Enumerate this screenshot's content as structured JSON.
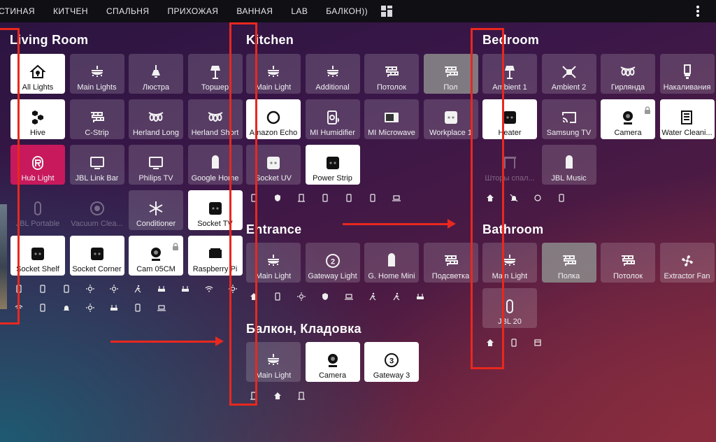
{
  "tabs": [
    "СТИНАЯ",
    "КИТЧЕН",
    "СПАЛЬНЯ",
    "ПРИХОЖАЯ",
    "ВАННАЯ",
    "LAB",
    "БАЛКОН))"
  ],
  "sections": {
    "living": "Living Room",
    "kitchen": "Kitchen",
    "bedroom": "Bedroom",
    "entrance": "Entrance",
    "bathroom": "Bathroom",
    "balcony": "Балкон, Кладовка"
  },
  "living": [
    {
      "label": "All Lights",
      "icon": "home-lightbulb-icon",
      "state": "on"
    },
    {
      "label": "Main Lights",
      "icon": "ceiling-light-icon",
      "state": "off"
    },
    {
      "label": "Люстра",
      "icon": "pendant-lamp-icon",
      "state": "off"
    },
    {
      "label": "Торшер",
      "icon": "floor-lamp-icon",
      "state": "off"
    },
    {
      "label": "Hive",
      "icon": "hexagon-icon",
      "state": "on"
    },
    {
      "label": "C-Strip",
      "icon": "led-strip-icon",
      "state": "off"
    },
    {
      "label": "Herland Long",
      "icon": "string-lights-icon",
      "state": "off"
    },
    {
      "label": "Herland Short",
      "icon": "string-lights-icon",
      "state": "off"
    },
    {
      "label": "Hub Light",
      "icon": "hub-icon",
      "state": "pink"
    },
    {
      "label": "JBL Link Bar",
      "icon": "monitor-icon",
      "state": "off"
    },
    {
      "label": "Philips TV",
      "icon": "monitor-icon",
      "state": "off"
    },
    {
      "label": "Google Home",
      "icon": "smart-speaker-icon",
      "state": "off"
    },
    {
      "label": "JBL Portable",
      "icon": "speaker-icon",
      "state": "dim"
    },
    {
      "label": "Vacuum Clea...",
      "icon": "robot-vacuum-icon",
      "state": "dim"
    },
    {
      "label": "Conditioner",
      "icon": "snowflake-icon",
      "state": "off"
    },
    {
      "label": "Socket TV",
      "icon": "socket-icon",
      "state": "on"
    },
    {
      "label": "Socket Shelf",
      "icon": "socket-icon",
      "state": "on"
    },
    {
      "label": "Socket Corner",
      "icon": "socket-icon",
      "state": "on"
    },
    {
      "label": "Cam 05CM",
      "icon": "webcam-icon",
      "state": "on",
      "lock": true
    },
    {
      "label": "Raspberry Pi",
      "icon": "raspberry-pi-icon",
      "state": "on"
    }
  ],
  "kitchen": [
    {
      "label": "Main Light",
      "icon": "ceiling-light-icon",
      "state": "off"
    },
    {
      "label": "Additional",
      "icon": "ceiling-light-icon",
      "state": "off"
    },
    {
      "label": "Потолок",
      "icon": "led-strip-icon",
      "state": "off"
    },
    {
      "label": "Пол",
      "icon": "led-strip-icon",
      "state": "gray"
    },
    {
      "label": "Amazon Echo",
      "icon": "echo-ring-icon",
      "state": "on"
    },
    {
      "label": "MI Humidifier",
      "icon": "humidifier-icon",
      "state": "off"
    },
    {
      "label": "MI Microwave",
      "icon": "microwave-icon",
      "state": "off"
    },
    {
      "label": "Workplace 1",
      "icon": "socket-icon",
      "state": "off"
    },
    {
      "label": "Socket UV",
      "icon": "socket-icon",
      "state": "off"
    },
    {
      "label": "Power Strip",
      "icon": "socket-icon",
      "state": "on"
    }
  ],
  "bedroom": [
    {
      "label": "Ambient 1",
      "icon": "floor-lamp-icon",
      "state": "off"
    },
    {
      "label": "Ambient 2",
      "icon": "spotlight-icon",
      "state": "off"
    },
    {
      "label": "Гирлянда",
      "icon": "string-lights-icon",
      "state": "off"
    },
    {
      "label": "Накаливания",
      "icon": "bulb-cfl-icon",
      "state": "off"
    },
    {
      "label": "Heater",
      "icon": "socket-icon",
      "state": "on"
    },
    {
      "label": "Samsung TV",
      "icon": "cast-icon",
      "state": "off"
    },
    {
      "label": "Camera",
      "icon": "webcam-icon",
      "state": "on",
      "lock": true
    },
    {
      "label": "Water Cleani...",
      "icon": "air-purifier-icon",
      "state": "on"
    },
    {
      "label": "Шторы спал...",
      "icon": "curtains-icon",
      "state": "dim"
    },
    {
      "label": "JBL Music",
      "icon": "smart-speaker-icon",
      "state": "off"
    }
  ],
  "entrance": [
    {
      "label": "Main Light",
      "icon": "ceiling-light-icon",
      "state": "off"
    },
    {
      "label": "Gateway Light",
      "icon": "gateway-2-icon",
      "state": "off"
    },
    {
      "label": "G. Home Mini",
      "icon": "smart-speaker-icon",
      "state": "off"
    },
    {
      "label": "Подсветка",
      "icon": "led-strip-icon",
      "state": "off"
    }
  ],
  "bathroom": [
    {
      "label": "Main Light",
      "icon": "ceiling-light-icon",
      "state": "off"
    },
    {
      "label": "Полка",
      "icon": "led-strip-icon",
      "state": "gray"
    },
    {
      "label": "Потолок",
      "icon": "led-strip-icon",
      "state": "off"
    },
    {
      "label": "Extractor Fan",
      "icon": "fan-icon",
      "state": "off"
    },
    {
      "label": "JBL 20",
      "icon": "speaker-icon",
      "state": "off"
    }
  ],
  "balcony": [
    {
      "label": "Main Light",
      "icon": "ceiling-light-icon",
      "state": "off"
    },
    {
      "label": "Camera",
      "icon": "webcam-icon",
      "state": "on"
    },
    {
      "label": "Gateway 3",
      "icon": "gateway-3-icon",
      "state": "on"
    }
  ],
  "colors": {
    "accent": "#c8195c",
    "annotation": "#e8281e",
    "topbar": "#0f0f14"
  }
}
